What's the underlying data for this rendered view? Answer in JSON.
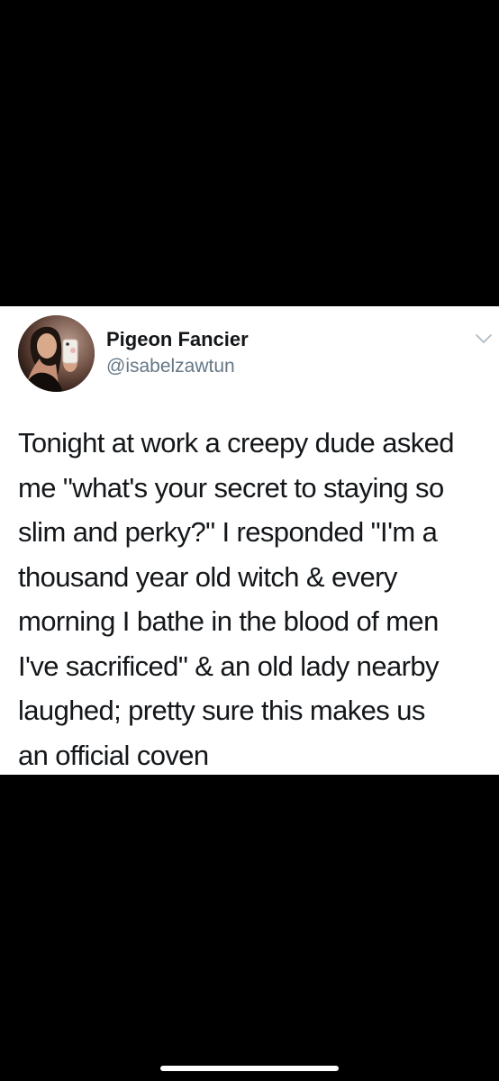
{
  "tweet": {
    "author_name": "Pigeon Fancier",
    "author_handle": "@isabelzawtun",
    "avatar_icon": "profile-photo",
    "menu_icon": "chevron-down-icon",
    "text_lines": [
      "Tonight at work a creepy dude asked",
      "me \"what's your secret to staying so",
      "slim and perky?\" I responded \"I'm a",
      "thousand year old witch & every",
      "morning I bathe in the blood of men",
      "I've sacrificed\" & an old lady nearby",
      "laughed; pretty sure this makes us",
      "an official coven"
    ]
  },
  "colors": {
    "background": "#000000",
    "card": "#ffffff",
    "name": "#14171a",
    "handle": "#657786"
  }
}
